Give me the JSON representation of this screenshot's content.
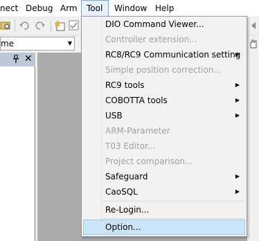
{
  "menubar": {
    "items": [
      {
        "label": "nect"
      },
      {
        "label": "Debug"
      },
      {
        "label": "Arm"
      },
      {
        "label": "Tool"
      },
      {
        "label": "Window"
      },
      {
        "label": "Help"
      }
    ]
  },
  "toolbar": {
    "combo_value": "me",
    "combo_arrow": "▼"
  },
  "panel": {
    "pin_glyph": "📌",
    "close_glyph": "✕"
  },
  "tool_menu": {
    "items": [
      {
        "label": "DIO Command Viewer...",
        "enabled": true,
        "submenu": false
      },
      {
        "label": "Controller extension...",
        "enabled": false,
        "submenu": false
      },
      {
        "label": "RC8/RC9 Communication setting",
        "enabled": true,
        "submenu": true
      },
      {
        "label": "Simple position correction...",
        "enabled": false,
        "submenu": false
      },
      {
        "label": "RC9 tools",
        "enabled": true,
        "submenu": true
      },
      {
        "label": "COBOTTA tools",
        "enabled": true,
        "submenu": true
      },
      {
        "label": "USB",
        "enabled": true,
        "submenu": true
      },
      {
        "label": "ARM-Parameter",
        "enabled": false,
        "submenu": false
      },
      {
        "label": "T03 Editor...",
        "enabled": false,
        "submenu": false
      },
      {
        "label": "Project comparison...",
        "enabled": false,
        "submenu": false
      },
      {
        "label": "Safeguard",
        "enabled": true,
        "submenu": true
      },
      {
        "label": "CaoSQL",
        "enabled": true,
        "submenu": true
      },
      {
        "label": "Re-Login...",
        "enabled": true,
        "submenu": false
      },
      {
        "label": "Option...",
        "enabled": true,
        "submenu": false,
        "highlighted": true
      }
    ],
    "submenu_arrow": "▶"
  },
  "colors": {
    "menu_highlight": "#cce4f7",
    "menubar_active": "#e5f1fb",
    "disabled_text": "#a0a0a0",
    "workspace": "#ababab"
  }
}
